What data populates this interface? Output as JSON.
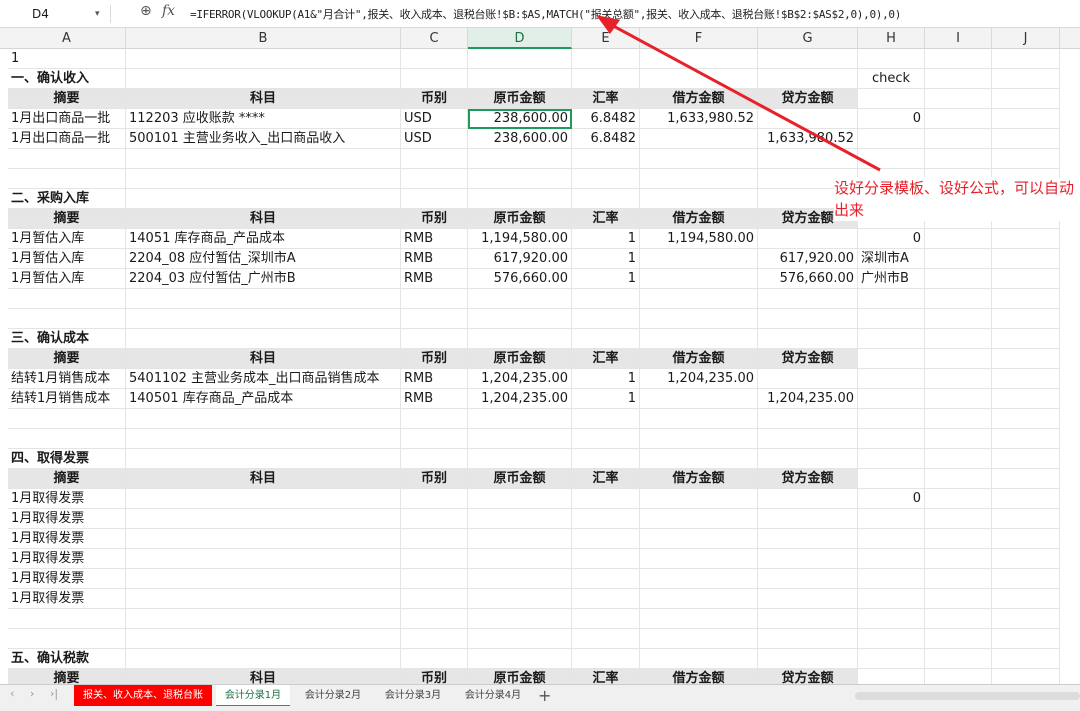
{
  "formula_bar": {
    "name_box": "D4",
    "fx_label": "fx",
    "formula": "=IFERROR(VLOOKUP(A1&\"月合计\",报关、收入成本、退税台账!$B:$AS,MATCH(\"报关总额\",报关、收入成本、退税台账!$B$2:$AS$2,0),0),0)"
  },
  "columns": [
    "A",
    "B",
    "C",
    "D",
    "E",
    "F",
    "G",
    "H",
    "I",
    "J"
  ],
  "header_labels": {
    "summary": "摘要",
    "account": "科目",
    "currency": "币别",
    "orig_amount": "原币金额",
    "rate": "汇率",
    "debit": "借方金额",
    "credit": "贷方金额"
  },
  "a1": "1",
  "check_label": "check",
  "sections": [
    {
      "title": "一、确认收入",
      "rows": [
        {
          "summary": "1月出口商品一批",
          "account": "112203 应收账款 ****",
          "currency": "USD",
          "orig": "238,600.00",
          "rate": "6.8482",
          "debit": "1,633,980.52",
          "credit": "",
          "h": "0"
        },
        {
          "summary": "1月出口商品一批",
          "account": "500101 主营业务收入_出口商品收入",
          "currency": "USD",
          "orig": "238,600.00",
          "rate": "6.8482",
          "debit": "",
          "credit": "1,633,980.52",
          "h": ""
        }
      ]
    },
    {
      "title": "二、采购入库",
      "rows": [
        {
          "summary": "1月暂估入库",
          "account": "14051 库存商品_产品成本",
          "currency": "RMB",
          "orig": "1,194,580.00",
          "rate": "1",
          "debit": "1,194,580.00",
          "credit": "",
          "h": "0"
        },
        {
          "summary": "1月暂估入库",
          "account": "2204_08 应付暂估_深圳市A",
          "currency": "RMB",
          "orig": "617,920.00",
          "rate": "1",
          "debit": "",
          "credit": "617,920.00",
          "h": "深圳市A"
        },
        {
          "summary": "1月暂估入库",
          "account": "2204_03 应付暂估_广州市B",
          "currency": "RMB",
          "orig": "576,660.00",
          "rate": "1",
          "debit": "",
          "credit": "576,660.00",
          "h": "广州市B"
        }
      ]
    },
    {
      "title": "三、确认成本",
      "rows": [
        {
          "summary": "结转1月销售成本",
          "account": "5401102 主营业务成本_出口商品销售成本",
          "currency": "RMB",
          "orig": "1,204,235.00",
          "rate": "1",
          "debit": "1,204,235.00",
          "credit": "",
          "h": ""
        },
        {
          "summary": "结转1月销售成本",
          "account": "140501 库存商品_产品成本",
          "currency": "RMB",
          "orig": "1,204,235.00",
          "rate": "1",
          "debit": "",
          "credit": "1,204,235.00",
          "h": ""
        }
      ]
    },
    {
      "title": "四、取得发票",
      "rows": [
        {
          "summary": "1月取得发票",
          "account": "",
          "currency": "",
          "orig": "",
          "rate": "",
          "debit": "",
          "credit": "",
          "h": "0"
        },
        {
          "summary": "1月取得发票",
          "account": "",
          "currency": "",
          "orig": "",
          "rate": "",
          "debit": "",
          "credit": "",
          "h": ""
        },
        {
          "summary": "1月取得发票",
          "account": "",
          "currency": "",
          "orig": "",
          "rate": "",
          "debit": "",
          "credit": "",
          "h": ""
        },
        {
          "summary": "1月取得发票",
          "account": "",
          "currency": "",
          "orig": "",
          "rate": "",
          "debit": "",
          "credit": "",
          "h": ""
        },
        {
          "summary": "1月取得发票",
          "account": "",
          "currency": "",
          "orig": "",
          "rate": "",
          "debit": "",
          "credit": "",
          "h": ""
        },
        {
          "summary": "1月取得发票",
          "account": "",
          "currency": "",
          "orig": "",
          "rate": "",
          "debit": "",
          "credit": "",
          "h": ""
        }
      ]
    },
    {
      "title": "五、确认税款",
      "rows": []
    }
  ],
  "annotation": "设好分录模板、设好公式，可以自动出来",
  "sheet_tabs": [
    {
      "label": "报关、收入成本、退税台账",
      "style": "red"
    },
    {
      "label": "会计分录1月",
      "style": "active"
    },
    {
      "label": "会计分录2月",
      "style": "normal"
    },
    {
      "label": "会计分录3月",
      "style": "normal"
    },
    {
      "label": "会计分录4月",
      "style": "normal"
    }
  ],
  "add_tab": "+",
  "colors": {
    "accent": "#1e9a5c",
    "annotation": "#e8202a",
    "red_tab": "#ff0000",
    "header_fill": "#e6e6e6"
  }
}
